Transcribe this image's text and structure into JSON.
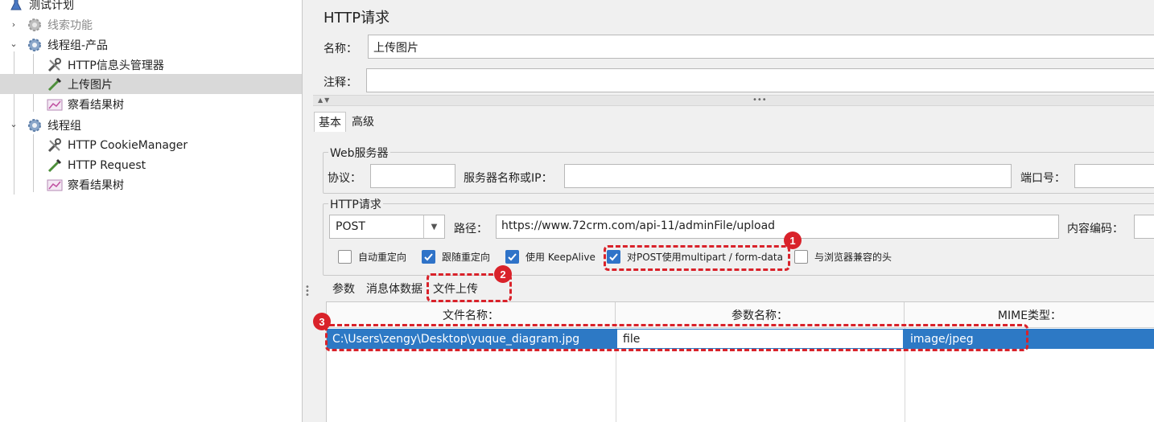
{
  "tree": {
    "items": [
      {
        "label": "测试计划"
      },
      {
        "label": "线索功能"
      },
      {
        "label": "线程组-产品"
      },
      {
        "label": "HTTP信息头管理器"
      },
      {
        "label": "上传图片"
      },
      {
        "label": "察看结果树"
      },
      {
        "label": "线程组"
      },
      {
        "label": "HTTP CookieManager"
      },
      {
        "label": "HTTP Request"
      },
      {
        "label": "察看结果树"
      }
    ]
  },
  "panel": {
    "title": "HTTP请求",
    "name_label": "名称：",
    "name_value": "上传图片",
    "comment_label": "注释：",
    "comment_value": "",
    "tabs": [
      "基本",
      "高级"
    ],
    "web_server": {
      "title": "Web服务器",
      "protocol_label": "协议：",
      "server_label": "服务器名称或IP：",
      "port_label": "端口号："
    },
    "http_request": {
      "title": "HTTP请求",
      "method": "POST",
      "path_label": "路径：",
      "path_value": "https://www.72crm.com/api-11/adminFile/upload",
      "encoding_label": "内容编码："
    },
    "checkboxes": [
      {
        "label": "自动重定向",
        "checked": false
      },
      {
        "label": "跟随重定向",
        "checked": true
      },
      {
        "label": "使用 KeepAlive",
        "checked": true
      },
      {
        "label": "对POST使用multipart / form-data",
        "checked": true
      },
      {
        "label": "与浏览器兼容的头",
        "checked": false
      }
    ],
    "subtabs": [
      "参数",
      "消息体数据",
      "文件上传"
    ],
    "table": {
      "headers": [
        "文件名称：",
        "参数名称：",
        "MIME类型："
      ],
      "rows": [
        [
          "C:\\Users\\zengy\\Desktop\\yuque_diagram.jpg",
          "file",
          "image/jpeg"
        ]
      ]
    }
  },
  "annotations": [
    "1",
    "2",
    "3"
  ],
  "colors": {
    "selection": "#2d79c5",
    "checkbox": "#2f73c8",
    "annotation": "#d9222a"
  }
}
